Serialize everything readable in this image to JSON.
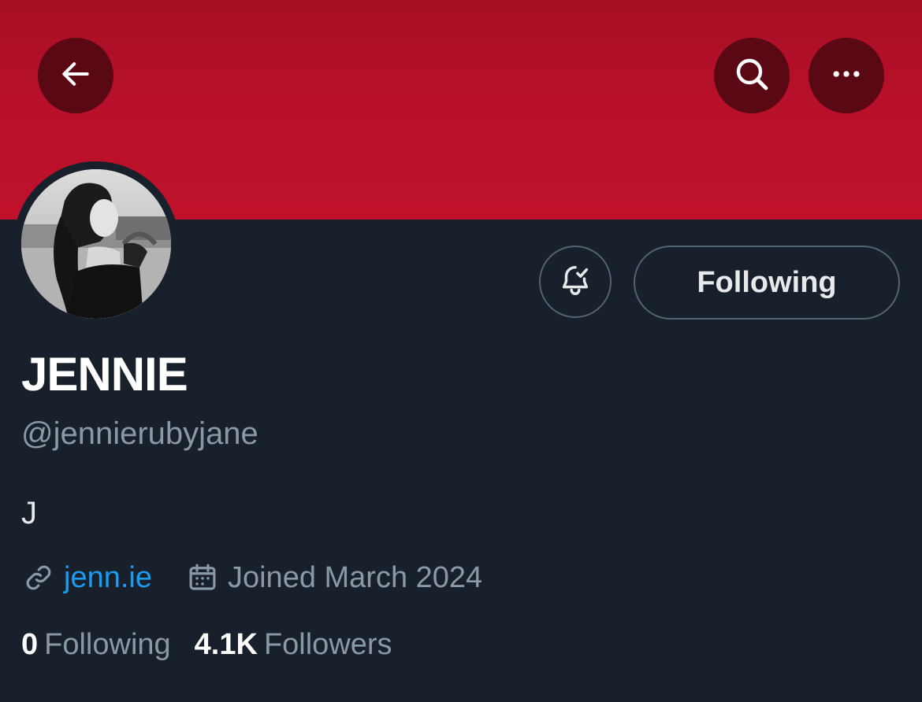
{
  "header": {
    "banner_color": "#b8102a",
    "back_icon": "arrow-left-icon",
    "search_icon": "search-icon",
    "more_icon": "more-horizontal-icon"
  },
  "profile": {
    "avatar_alt": "profile-photo",
    "display_name": "JENNIE",
    "handle": "@jennierubyjane",
    "bio": "J",
    "website": "jenn.ie",
    "joined": "Joined March 2024"
  },
  "actions": {
    "notifications_icon": "bell-check-icon",
    "follow_label": "Following"
  },
  "stats": {
    "following_count": "0",
    "following_label": "Following",
    "followers_count": "4.1K",
    "followers_label": "Followers"
  },
  "colors": {
    "background": "#17202b",
    "accent_link": "#1d9bf0",
    "muted_text": "#8b98a5",
    "button_border": "#536471"
  }
}
